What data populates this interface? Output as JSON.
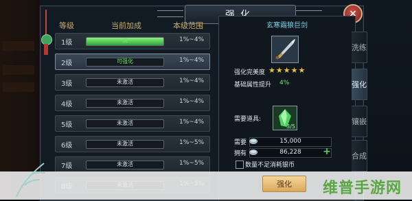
{
  "title": "强化",
  "close_icon": "×",
  "table": {
    "headers": {
      "level": "等级",
      "bonus": "当前加成",
      "range": "本级范围"
    },
    "rows": [
      {
        "level": "1级",
        "status": "满",
        "range": "1%~4%",
        "fill": 1.0,
        "status_color": "#72e266"
      },
      {
        "level": "2级",
        "status": "可强化",
        "range": "1%~4%",
        "fill": 0.0,
        "status_color": "#72e266",
        "selected": true
      },
      {
        "level": "3级",
        "status": "未激活",
        "range": "1%~4%",
        "fill": 0.0
      },
      {
        "level": "4级",
        "status": "未激活",
        "range": "1%~4%",
        "fill": 0.0
      },
      {
        "level": "5级",
        "status": "未激活",
        "range": "1%~4%",
        "fill": 0.0
      },
      {
        "level": "6级",
        "status": "未激活",
        "range": "1%~5%",
        "fill": 0.0
      },
      {
        "level": "7级",
        "status": "未激活",
        "range": "1%~5%",
        "fill": 0.0
      },
      {
        "level": "8级",
        "status": "未激活",
        "range": "1%~5%",
        "fill": 0.0
      }
    ]
  },
  "item": {
    "name": "玄寒霜狼巨剑",
    "perfection_label": "强化完美度",
    "stars": "★★★★★",
    "attr_label": "基础属性提升",
    "attr_value": "4%",
    "need_item_label": "需要道具:",
    "gem_count": "3/5",
    "cost_need_label": "需要",
    "cost_need_value": "15,000",
    "cost_own_label": "拥有",
    "cost_own_value": "86,228",
    "plus": "+",
    "checkbox_label": "数量不足消耗银币"
  },
  "tabs": [
    {
      "label": "洗练",
      "active": false
    },
    {
      "label": "强化",
      "active": true
    },
    {
      "label": "镶嵌",
      "active": false
    },
    {
      "label": "合成",
      "active": false
    }
  ],
  "enhance_button": "强化",
  "watermark": "维普手游网"
}
